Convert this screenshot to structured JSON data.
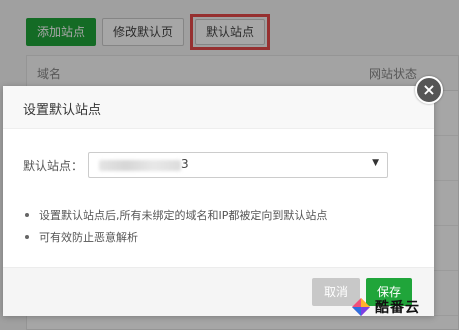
{
  "toolbar": {
    "add_site": "添加站点",
    "modify_default_page": "修改默认页",
    "default_site": "默认站点"
  },
  "table": {
    "col_domain": "域名",
    "col_status": "网站状态"
  },
  "modal": {
    "title": "设置默认站点",
    "field_label": "默认站点：",
    "select_value_visible_suffix": "3",
    "notes": [
      "设置默认站点后,所有未绑定的域名和IP都被定向到默认站点",
      "可有效防止恶意解析"
    ],
    "cancel": "取消",
    "save": "保存",
    "close_glyph": "×"
  },
  "watermark": {
    "text": "酷番云"
  },
  "colors": {
    "accent_green": "#20a53a",
    "highlight_red": "#e64a4a",
    "cancel_gray": "#c8c8c8"
  },
  "icons": {
    "close": "close-icon",
    "dropdown": "chevron-down-icon",
    "bullet": "bullet-icon",
    "watermark": "logo-icon"
  }
}
